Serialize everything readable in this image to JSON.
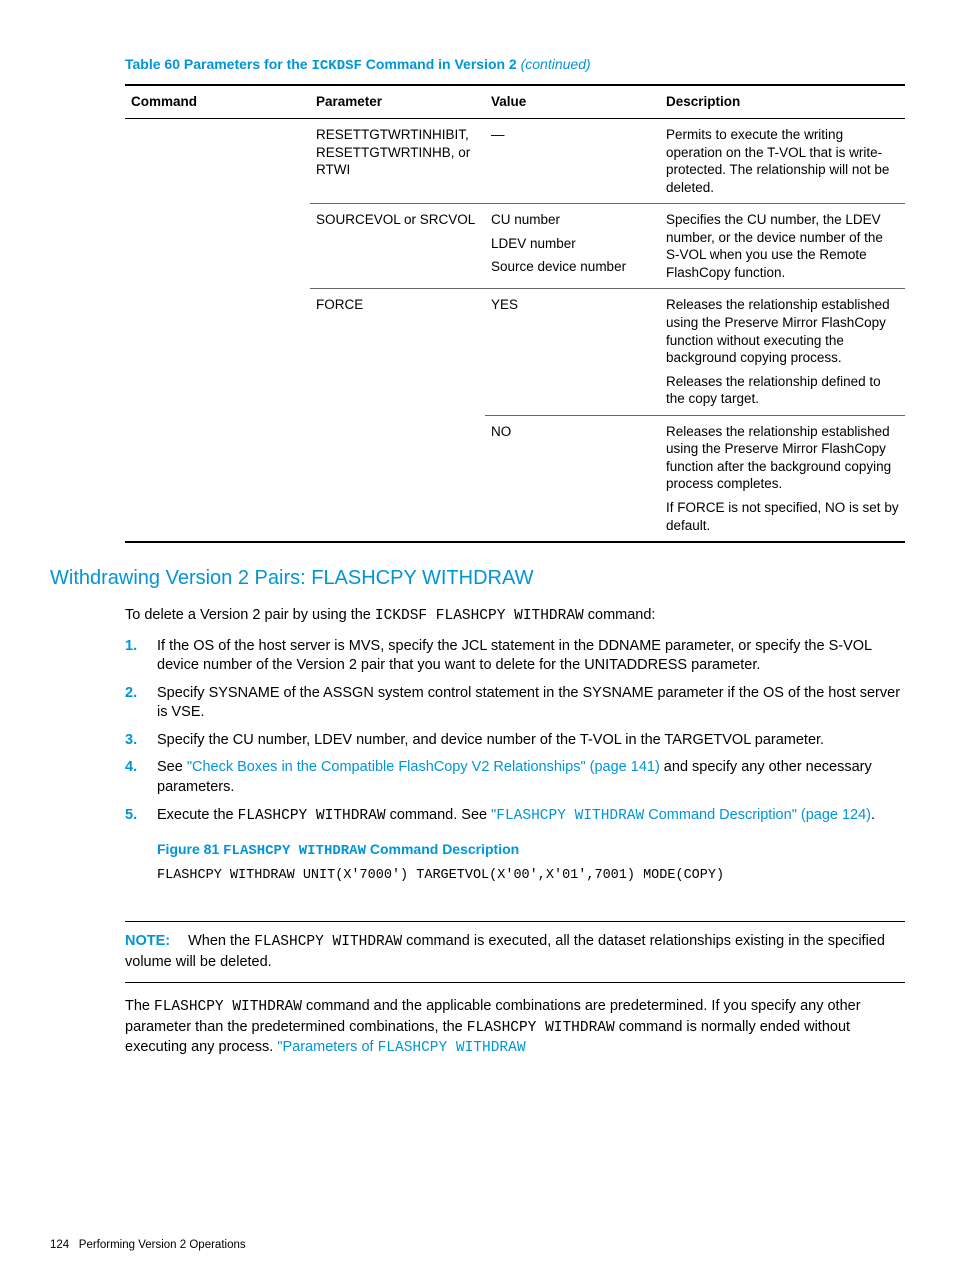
{
  "table_caption": {
    "prefix": "Table 60 Parameters for the ",
    "code": "ICKDSF",
    "suffix": " Command in Version 2 ",
    "cont": "(continued)"
  },
  "headers": {
    "c1": "Command",
    "c2": "Parameter",
    "c3": "Value",
    "c4": "Description"
  },
  "rows": {
    "r1": {
      "param": "RESETTGTWRTINHIBIT, RESETTGTWRTINHB, or RTWI",
      "value": "—",
      "desc": "Permits to execute the writing operation on the T-VOL that is write-protected. The relationship will not be deleted."
    },
    "r2": {
      "param": "SOURCEVOL or SRCVOL",
      "v1": "CU number",
      "v2": "LDEV number",
      "v3": "Source device number",
      "desc": "Specifies the CU number, the LDEV number, or the device number of the S-VOL when you use the Remote FlashCopy function."
    },
    "r3": {
      "param": "FORCE",
      "value": "YES",
      "d1": "Releases the relationship established using the Preserve Mirror FlashCopy function without executing the background copying process.",
      "d2": "Releases the relationship defined to the copy target."
    },
    "r4": {
      "value": "NO",
      "d1": "Releases the relationship established using the Preserve Mirror FlashCopy function after the background copying process completes.",
      "d2": "If FORCE is not specified, NO is set by default."
    }
  },
  "section_title": "Withdrawing Version 2 Pairs: FLASHCPY WITHDRAW",
  "intro": {
    "p1a": "To delete a Version 2 pair by using the ",
    "p1code": "ICKDSF FLASHCPY WITHDRAW",
    "p1b": " command:"
  },
  "steps": {
    "s1": "If the OS of the host server is MVS, specify the JCL statement in the DDNAME parameter, or specify the S-VOL device number of the Version 2 pair that you want to delete for the UNITADDRESS parameter.",
    "s2": "Specify SYSNAME of the ASSGN system control statement in the SYSNAME parameter if the OS of the host server is VSE.",
    "s3": "Specify the CU number, LDEV number, and device number of the T-VOL in the TARGETVOL parameter.",
    "s4a": "See ",
    "s4link": "\"Check Boxes in the Compatible FlashCopy V2 Relationships\" (page 141)",
    "s4b": " and specify any other necessary parameters.",
    "s5a": "Execute the ",
    "s5code": "FLASHCPY WITHDRAW",
    "s5b": " command. See ",
    "s5link_open": "\"",
    "s5link_code": "FLASHCPY WITHDRAW",
    "s5link_rest": " Command Description\" (page 124)",
    "s5c": "."
  },
  "figure": {
    "prefix": "Figure 81 ",
    "code": "FLASHCPY WITHDRAW",
    "suffix": " Command Description"
  },
  "codeblock": "FLASHCPY WITHDRAW UNIT(X'7000') TARGETVOL(X'00',X'01',7001) MODE(COPY)",
  "note": {
    "label": "NOTE:",
    "t1": "When the ",
    "c1": "FLASHCPY WITHDRAW",
    "t2": " command is executed, all the dataset relationships existing in the specified volume will be deleted."
  },
  "trailing": {
    "t1": "The ",
    "c1": "FLASHCPY WITHDRAW",
    "t2": " command and the applicable combinations are predetermined. If you specify any other parameter than the predetermined combinations, the ",
    "c2": "FLASHCPY WITHDRAW",
    "t3": " command is normally ended without executing any process. ",
    "link_t": "\"Parameters of ",
    "link_c": "FLASHCPY WITHDRAW"
  },
  "footer": {
    "page": "124",
    "title": "Performing Version 2 Operations"
  }
}
